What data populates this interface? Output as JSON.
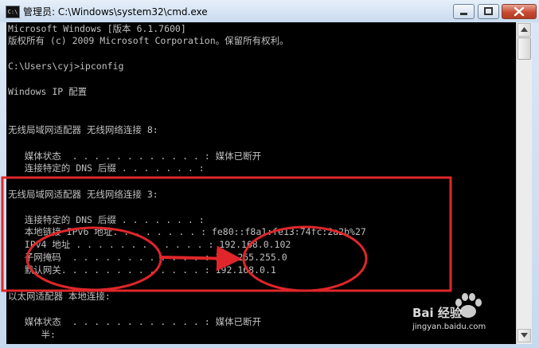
{
  "window": {
    "icon_label": "C:\\",
    "title": "管理员: C:\\Windows\\system32\\cmd.exe"
  },
  "console": {
    "lines": [
      "Microsoft Windows [版本 6.1.7600]",
      "版权所有 (c) 2009 Microsoft Corporation。保留所有权利。",
      "",
      "C:\\Users\\cyj>ipconfig",
      "",
      "Windows IP 配置",
      "",
      "",
      "无线局域网适配器 无线网络连接 8:",
      "",
      "   媒体状态  . . . . . . . . . . . . : 媒体已断开",
      "   连接特定的 DNS 后缀 . . . . . . . :",
      "",
      "无线局域网适配器 无线网络连接 3:",
      "",
      "   连接特定的 DNS 后缀 . . . . . . . :",
      "   本地链接 IPv6 地址. . . . . . . . : fe80::f8a1:fe13:74fc:2a2b%27",
      "   IPv4 地址 . . . . . . . . . . . . : 192.168.0.102",
      "   子网掩码  . . . . . . . . . . . . : 255.255.255.0",
      "   默认网关. . . . . . . . . . . . . : 192.168.0.1",
      "",
      "以太网适配器 本地连接:",
      "",
      "   媒体状态  . . . . . . . . . . . . : 媒体已断开",
      "      半:"
    ]
  },
  "watermark": {
    "brand": "Bai 经验",
    "url": "jingyan.baidu.com"
  },
  "colors": {
    "console_bg": "#000000",
    "console_text": "#c0c0c0",
    "annotation": "#e0262a"
  }
}
